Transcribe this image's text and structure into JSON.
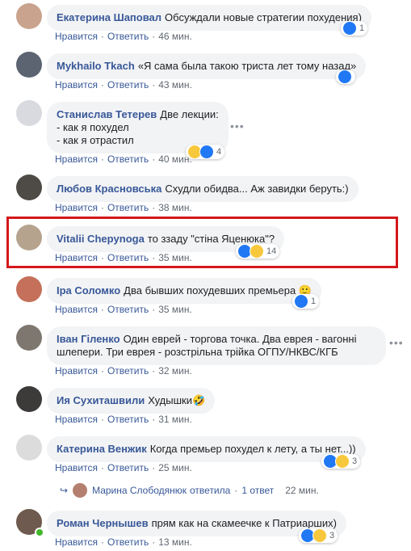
{
  "actions": {
    "like": "Нравится",
    "reply": "Ответить"
  },
  "comments": [
    {
      "author": "Екатерина Шаповал",
      "text": "Обсуждали новые стратегии похудения)",
      "time": "46 мин.",
      "reactions": {
        "icons": [
          "like"
        ],
        "count": "1"
      }
    },
    {
      "author": "Mykhailo Tkach",
      "text": "«Я сама была такою триста лет тому назад»",
      "time": "43 мин.",
      "reactions": {
        "icons": [
          "like"
        ],
        "count": ""
      }
    },
    {
      "author": "Станислав Тетерев",
      "text_lines": [
        "Две лекции:",
        "- как я похудел",
        "- как я отрастил"
      ],
      "time": "40 мин.",
      "reactions": {
        "icons": [
          "haha",
          "like"
        ],
        "count": "4"
      },
      "more": "•••"
    },
    {
      "author": "Любов Красновська",
      "text": "Схудли обидва... Аж завидки беруть:)",
      "time": "38 мин."
    },
    {
      "author": "Vitalii Chepynoga",
      "text": "то ззаду \"стіна Яценюка\"?",
      "time": "35 мин.",
      "reactions": {
        "icons": [
          "like",
          "haha"
        ],
        "count": "14"
      }
    },
    {
      "author": "Іра Соломко",
      "text": "Два бывших похудевших премьера",
      "emoji": "🙂",
      "time": "35 мин.",
      "reactions": {
        "icons": [
          "like"
        ],
        "count": "1"
      }
    },
    {
      "author": "Іван Гіленко",
      "text_lines": [
        "Один еврей - торгова точка. Два еврея - вагонні",
        "шлепери. Три еврея - розстрільна трійка ОГПУ/НКВС/КГБ"
      ],
      "time": "32 мин.",
      "more": "•••"
    },
    {
      "author": "Ия Сухиташвили",
      "text": "Худышки",
      "emoji": "🤣",
      "time": "31 мин."
    },
    {
      "author": "Катерина Венжик",
      "text": "Когда премьер похудел к лету, а ты нет...))",
      "time": "25 мин.",
      "reactions": {
        "icons": [
          "like",
          "haha"
        ],
        "count": "3"
      }
    },
    {
      "author": "Роман Чернышев",
      "text": "прям как на скамеечке к Патриарших)",
      "time": "13 мин.",
      "reactions": {
        "icons": [
          "like",
          "haha"
        ],
        "count": "3"
      }
    }
  ],
  "reply_summary": {
    "name": "Марина Слободянюк",
    "verb": "ответила",
    "sep": "·",
    "count": "1 ответ",
    "time": "22 мин."
  },
  "colors": {
    "link": "#385898",
    "bubble": "#f2f3f5",
    "highlight": "#d4181b",
    "like": "#2078f4",
    "haha": "#f7c83c"
  }
}
